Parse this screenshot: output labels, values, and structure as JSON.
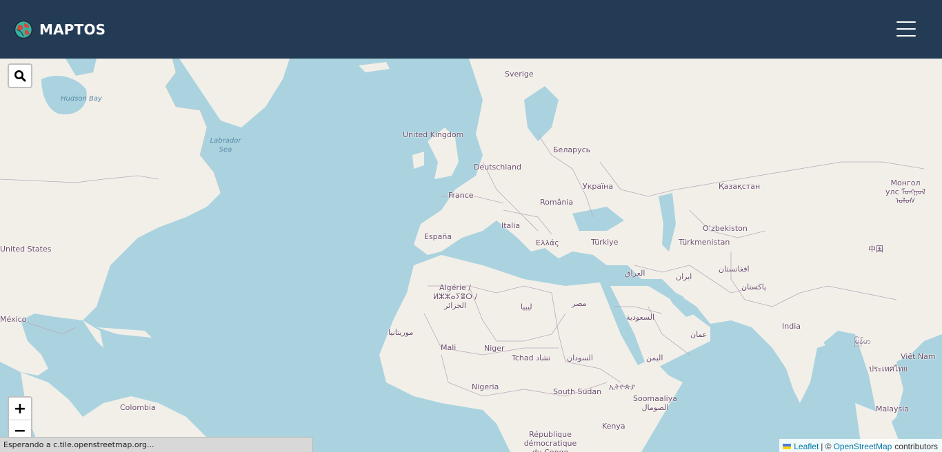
{
  "header": {
    "brand": "MAPTOS",
    "logo_icon": "globe-icon",
    "menu_icon": "hamburger-menu-icon"
  },
  "map": {
    "tile_source": "OpenStreetMap",
    "labels": {
      "sverige": "Sverige",
      "hudson": "Hudson Bay",
      "labrador": "Labrador Sea",
      "uk": "United Kingdom",
      "belarus": "Беларусь",
      "deutschland": "Deutschland",
      "ukraina": "Україна",
      "kazakhstan": "Қазақстан",
      "mongol": "Монгол улс ᠮᠤᠩᠭᠤᠯ ᠤᠯᠤᠰ",
      "france": "France",
      "romania": "România",
      "uzbekiston": "O‘zbekiston",
      "italia": "Italia",
      "espana": "España",
      "ellas": "Ελλάς",
      "turkiye": "Türkiye",
      "turkmenistan": "Türkmenistan",
      "united_states": "United States",
      "china": "中国",
      "iraq": "العراق",
      "iran": "ایران",
      "afghanistan": "افغانستان",
      "pakistan": "پاکستان",
      "algerie": "Algérie / ⵍⵣⵣⴰⵢⴻⵔ / الجزائر",
      "libya": "ليبيا",
      "misr": "مصر",
      "saudi": "السعودية",
      "mexico": "México",
      "india": "India",
      "oman": "عمان",
      "mauritania": "موريتانيا",
      "myanmar": "မြန်မာ",
      "mali": "Mali",
      "niger": "Niger",
      "tchad": "Tchad تشاد",
      "sudan": "السودان",
      "yemen": "اليمن",
      "vietnam": "Việt Nam",
      "thailand": "ประเทศไทย",
      "nigeria": "Nigeria",
      "south_sudan": "South Sudan",
      "ethiopia": "ኢትዮጵያ",
      "somalia": "Soomaaliya الصومال",
      "colombia": "Colombia",
      "kenya": "Kenya",
      "malaysia": "Malaysia",
      "rdc": "République démocratique du Congo"
    }
  },
  "controls": {
    "search_icon": "search-icon",
    "zoom_in": "+",
    "zoom_out": "−"
  },
  "status_bar": {
    "text": "Esperando a c.tile.openstreetmap.org..."
  },
  "attribution": {
    "leaflet": "Leaflet",
    "separator": "| ©",
    "osm": "OpenStreetMap",
    "suffix": "contributors"
  },
  "colors": {
    "header_bg": "#243b55",
    "water": "#aad3df",
    "land": "#f2efe9",
    "border": "#b9a8b9",
    "link": "#0078a8"
  }
}
